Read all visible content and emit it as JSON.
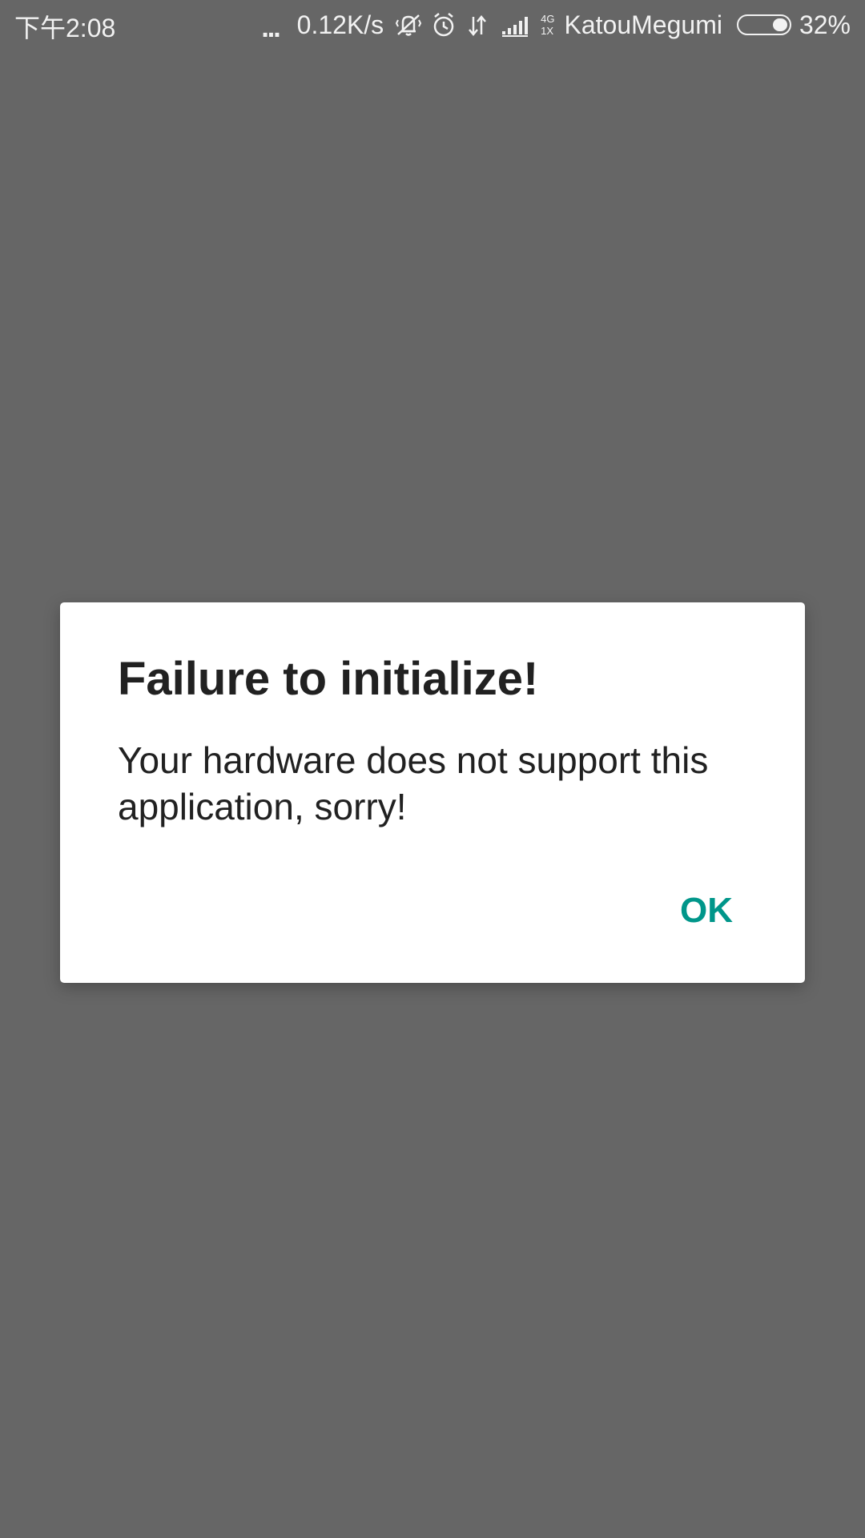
{
  "status_bar": {
    "time": "下午2:08",
    "more_indicator": "...",
    "network_speed": "0.12K/s",
    "icons": [
      "vibrate-off-icon",
      "alarm-icon",
      "data-transfer-icon",
      "signal-icon"
    ],
    "network_type_top": "4G",
    "network_type_bottom": "1X",
    "carrier": "KatouMegumi",
    "battery_percent": "32%",
    "battery_level": 0.32
  },
  "dialog": {
    "title": "Failure to initialize!",
    "message": "Your hardware does not support this application, sorry!",
    "ok_label": "OK"
  },
  "colors": {
    "background": "#666666",
    "dialog_background": "#ffffff",
    "text": "#212121",
    "accent": "#00968a"
  }
}
